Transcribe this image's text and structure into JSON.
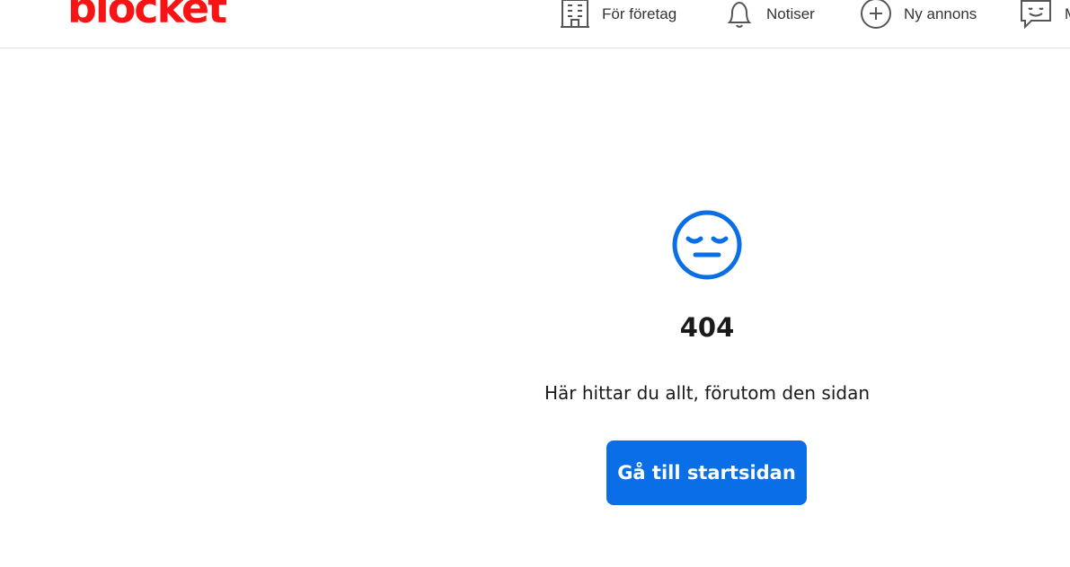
{
  "header": {
    "logo_text": "blocket",
    "nav": {
      "foretag_label": "För företag",
      "notiser_label": "Notiser",
      "ny_annons_label": "Ny annons",
      "messages_label": "M"
    }
  },
  "error": {
    "code": "404",
    "message": "Här hittar du allt, förutom den sidan",
    "button_label": "Gå till startsidan"
  },
  "colors": {
    "brand_red": "#f71414",
    "accent_blue": "#0a6ee6",
    "face_blue": "#0a6ee6"
  },
  "icons": {
    "foretag": "building-icon",
    "notiser": "bell-icon",
    "ny_annons": "plus-circle-icon",
    "messages": "chat-smile-icon",
    "error": "sad-face-icon"
  }
}
